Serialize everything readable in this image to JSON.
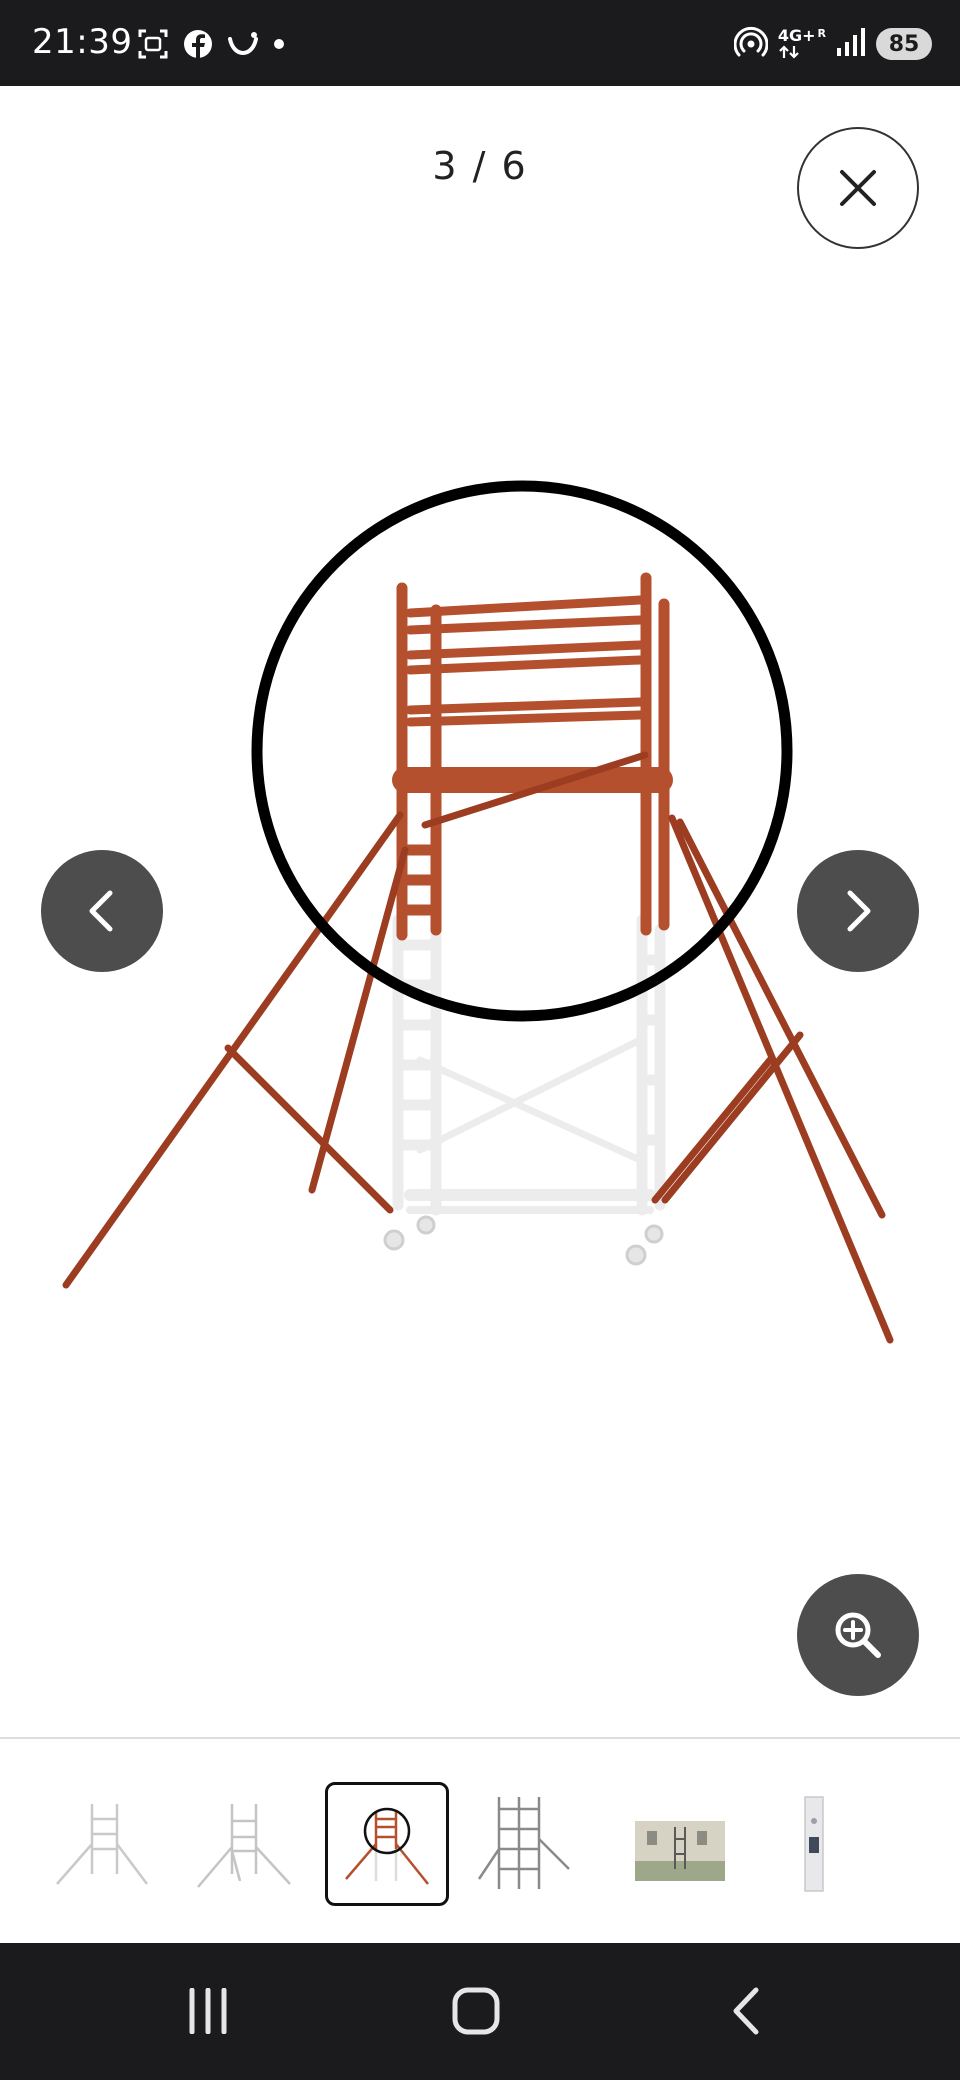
{
  "status_bar": {
    "time": "21:39",
    "network_label": "4G+",
    "roaming_label": "R",
    "battery": "85",
    "left_icons": [
      "screenshot-icon",
      "facebook-icon",
      "smile-icon",
      "dot-icon"
    ],
    "right_icons": [
      "hotspot-icon",
      "signal-icon"
    ]
  },
  "viewer": {
    "counter": "3 / 6",
    "icons": {
      "close": "close-icon",
      "previous": "chevron-left-icon",
      "next": "chevron-right-icon",
      "zoom": "zoom-in-icon"
    },
    "image_subject": "scaffolding tower with outriggers"
  },
  "thumbnails": [
    {
      "subject": "scaffold-white-outriggers",
      "active": false
    },
    {
      "subject": "scaffold-white-outriggers-angle",
      "active": false
    },
    {
      "subject": "scaffold-highlight-circle",
      "active": true
    },
    {
      "subject": "scaffold-tower-detail",
      "active": false
    },
    {
      "subject": "scaffold-building-photo",
      "active": false
    },
    {
      "subject": "scaffold-part-closeup",
      "active": false
    }
  ],
  "system_nav": {
    "icons": [
      "recent-apps-icon",
      "home-icon",
      "back-icon"
    ]
  },
  "colors": {
    "scaffold_orange": "#b5502f",
    "button_gray": "#4d4d4d",
    "bar_dark": "#1b1b1d"
  }
}
